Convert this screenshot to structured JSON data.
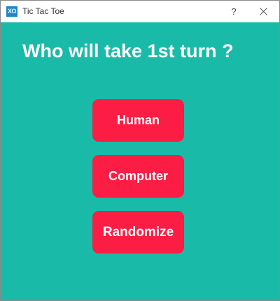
{
  "window": {
    "icon_text": "XO",
    "title": "Tic Tac Toe",
    "help_label": "?"
  },
  "main": {
    "question": "Who will take 1st turn ?",
    "buttons": [
      {
        "label": "Human"
      },
      {
        "label": "Computer"
      },
      {
        "label": "Randomize"
      }
    ]
  },
  "colors": {
    "background": "#1abaa8",
    "button": "#fb1d44",
    "text": "#ffffff"
  },
  "icons": {
    "app": "xo-app-icon",
    "help": "help-icon",
    "close": "close-icon"
  }
}
